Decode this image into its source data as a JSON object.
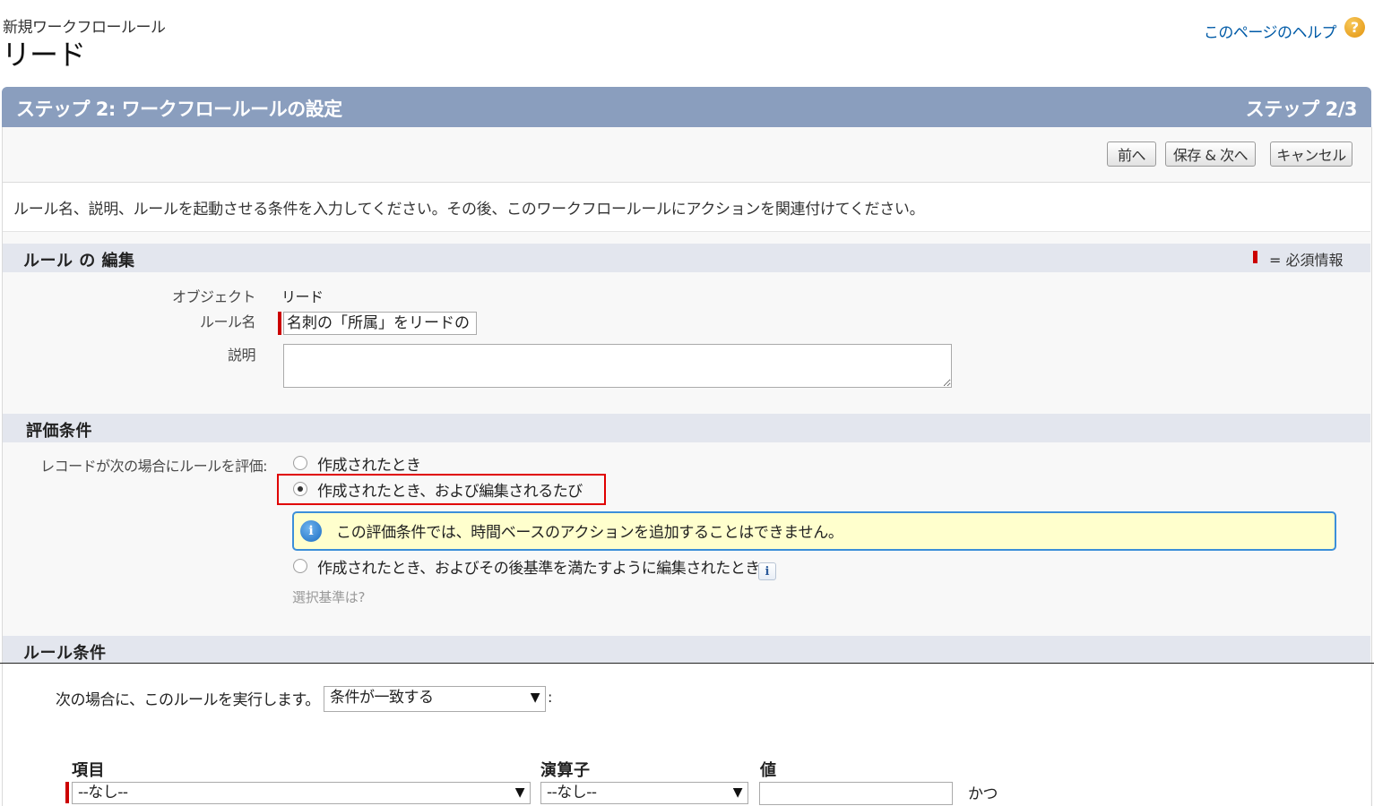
{
  "header": {
    "eyebrow": "新規ワークフロールール",
    "title": "リード",
    "help_link": "このページのヘルプ",
    "help_icon": "question-icon"
  },
  "step": {
    "title": "ステップ 2: ワークフロールールの設定",
    "counter": "ステップ 2/3"
  },
  "buttons": {
    "prev": "前へ",
    "save_next": "保存 & 次へ",
    "cancel": "キャンセル"
  },
  "intro": "ルール名、説明、ルールを起動させる条件を入力してください。その後、このワークフロールールにアクションを関連付けてください。",
  "rule_edit": {
    "section_title": "ルール の 編集",
    "required_legend": "= 必須情報",
    "object_label": "オブジェクト",
    "object_value": "リード",
    "rule_name_label": "ルール名",
    "rule_name_value": "名刺の「所属」をリードの「部",
    "description_label": "説明",
    "description_value": ""
  },
  "evaluation": {
    "section_title": "評価条件",
    "label": "レコードが次の場合にルールを評価:",
    "options": [
      {
        "label": "作成されたとき",
        "selected": false
      },
      {
        "label": "作成されたとき、および編集されるたび",
        "selected": true
      },
      {
        "label": "作成されたとき、およびその後基準を満たすように編集されたとき",
        "selected": false
      }
    ],
    "info_message": "この評価条件では、時間ベースのアクションを追加することはできません。",
    "criteria_help_link": "選択基準は?",
    "highlight_color": "#e00000"
  },
  "rule_criteria": {
    "section_title": "ルール条件",
    "run_label": "次の場合に、このルールを実行します。",
    "run_select_value": "条件が一致する",
    "run_suffix": ":",
    "columns": {
      "field": "項目",
      "operator": "演算子",
      "value": "値"
    },
    "rows": [
      {
        "field": "--なし--",
        "operator": "--なし--",
        "value": "",
        "conjunction": "かつ"
      }
    ]
  },
  "colors": {
    "step_header_bg": "#8a9ebe",
    "section_bar_bg": "#e3e6ee",
    "required": "#cc0000",
    "link": "#015ba7",
    "info_bg": "#ffffcd",
    "info_border": "#3c8fd9"
  }
}
